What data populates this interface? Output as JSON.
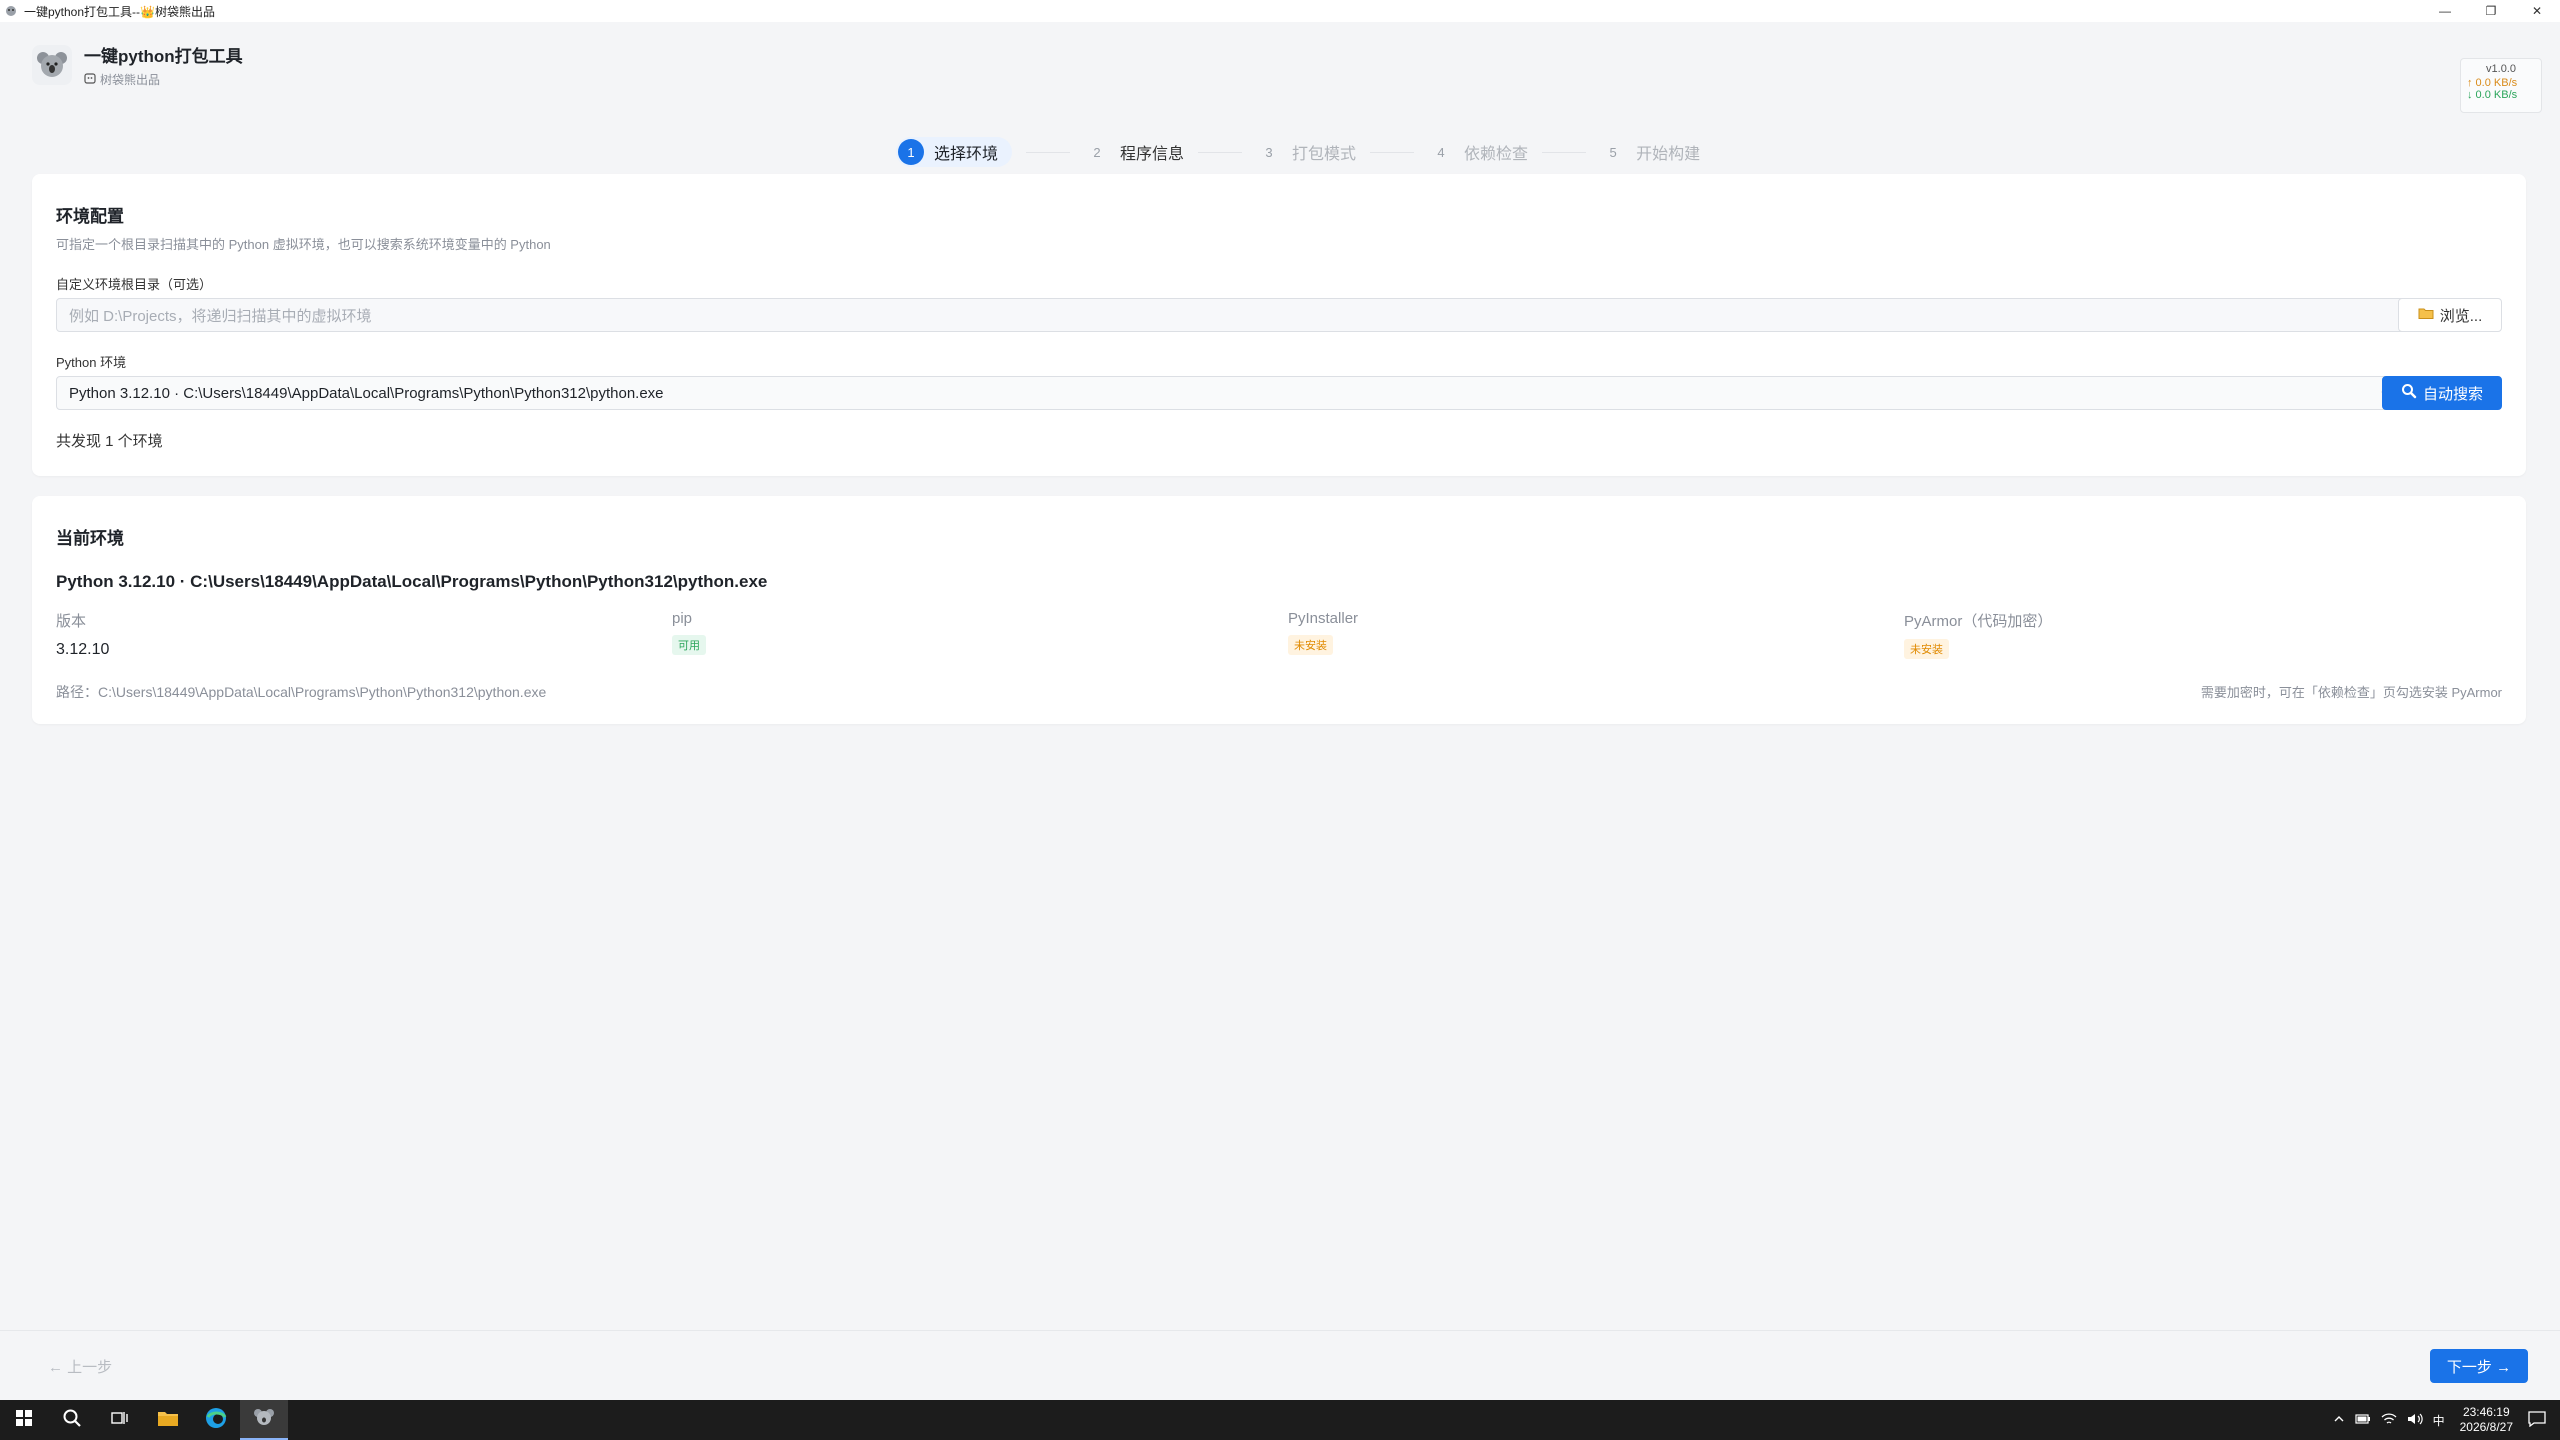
{
  "window": {
    "title": "一键python打包工具--👑树袋熊出品",
    "minimize": "—",
    "maximize": "❐",
    "close": "✕"
  },
  "header": {
    "app_title": "一键python打包工具",
    "subtitle": "树袋熊出品",
    "version": "v1.0.0",
    "upload_speed": "↑ 0.0 KB/s",
    "download_speed": "↓ 0.0 KB/s"
  },
  "steps": [
    {
      "num": "1",
      "label": "选择环境",
      "state": "active"
    },
    {
      "num": "2",
      "label": "程序信息",
      "state": "done"
    },
    {
      "num": "3",
      "label": "打包模式",
      "state": "pending"
    },
    {
      "num": "4",
      "label": "依赖检查",
      "state": "pending"
    },
    {
      "num": "5",
      "label": "开始构建",
      "state": "pending"
    }
  ],
  "env_config": {
    "title": "环境配置",
    "description": "可指定一个根目录扫描其中的 Python 虚拟环境，也可以搜索系统环境变量中的 Python",
    "root_label": "自定义环境根目录（可选）",
    "root_placeholder": "例如 D:\\Projects，将递归扫描其中的虚拟环境",
    "browse_label": "浏览...",
    "python_label": "Python 环境",
    "python_selected": "Python 3.12.10 · C:\\Users\\18449\\AppData\\Local\\Programs\\Python\\Python312\\python.exe",
    "auto_search_label": "自动搜索",
    "found_text": "共发现 1 个环境"
  },
  "current_env": {
    "title": "当前环境",
    "name": "Python 3.12.10 · C:\\Users\\18449\\AppData\\Local\\Programs\\Python\\Python312\\python.exe",
    "version_label": "版本",
    "version_value": "3.12.10",
    "pip_label": "pip",
    "pip_status": "可用",
    "pyinstaller_label": "PyInstaller",
    "pyinstaller_status": "未安装",
    "pyarmor_label": "PyArmor（代码加密）",
    "pyarmor_status": "未安装",
    "path_text": "路径：C:\\Users\\18449\\AppData\\Local\\Programs\\Python\\Python312\\python.exe",
    "hint": "需要加密时，可在「依赖检查」页勾选安装 PyArmor"
  },
  "nav": {
    "prev_label": "← 上一步",
    "next_label": "下一步 →"
  },
  "taskbar": {
    "time": "23:46:19",
    "date": "2026/8/27",
    "ime": "中"
  },
  "colors": {
    "accent": "#1a73e8",
    "ok": "#2ba55b",
    "warn": "#e08a00"
  }
}
